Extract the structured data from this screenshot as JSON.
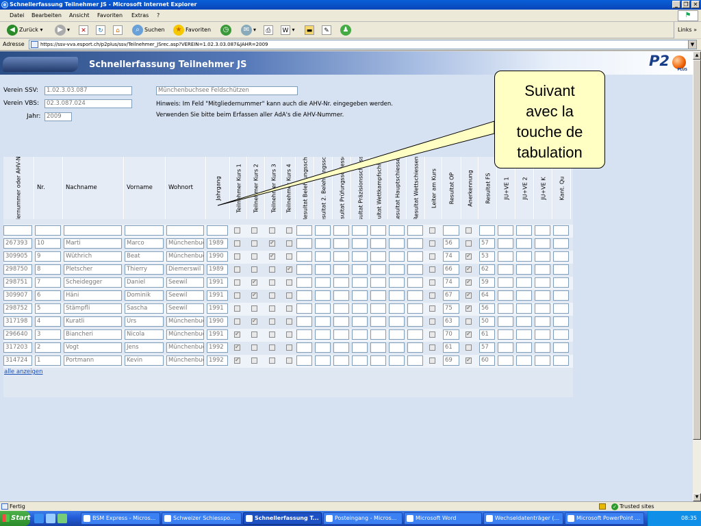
{
  "window": {
    "title": "Schnellerfassung Teilnehmer JS - Microsoft Internet Explorer",
    "min": "_",
    "max": "❐",
    "close": "✕"
  },
  "menu": [
    "Datei",
    "Bearbeiten",
    "Ansicht",
    "Favoriten",
    "Extras",
    "?"
  ],
  "toolbar": {
    "back": "Zurück",
    "search": "Suchen",
    "favorites": "Favoriten",
    "links": "Links"
  },
  "address": {
    "label": "Adresse",
    "url": "https://ssv-vva.esport.ch/p2plus/ssv/Teilnehmer_JSrec.asp?VEREIN=1.02.3.03.087&JAHR=2009"
  },
  "page": {
    "title": "Schnellerfassung Teilnehmer JS",
    "logo": "P2",
    "logo_sub": "PLUS"
  },
  "form": {
    "verein_ssv_label": "Verein SSV:",
    "verein_ssv": "1.02.3.03.087",
    "verein_vbs_label": "Verein VBS:",
    "verein_vbs": "02.3.087.024",
    "jahr_label": "Jahr:",
    "jahr": "2009",
    "verein_name": "Münchenbuchsee Feldschützen",
    "hint1": "Hinweis: Im Feld \"Mitgliedernummer\" kann auch die AHV-Nr. eingegeben werden.",
    "hint2": "Verwenden Sie bitte beim Erfassen aller AdA's die AHV-Nummer."
  },
  "columns": [
    {
      "label": "Mitgliedernummer oder AHV-Nummer",
      "rot": true
    },
    {
      "label": "Nr.",
      "rot": false
    },
    {
      "label": "Nachname",
      "rot": false
    },
    {
      "label": "Vorname",
      "rot": false
    },
    {
      "label": "Wohnort",
      "rot": false
    },
    {
      "label": "Jahrgang",
      "rot": true
    },
    {
      "label": "Teilnehmer Kurs 1",
      "rot": true
    },
    {
      "label": "Teilnehmer Kurs 2",
      "rot": true
    },
    {
      "label": "Teilnehmer Kurs 3",
      "rot": true
    },
    {
      "label": "Teilnehmer Kurs 4",
      "rot": true
    },
    {
      "label": "Resultat Belehrungssch.",
      "rot": true
    },
    {
      "label": "Resultat 2. Belehrungssch.",
      "rot": true
    },
    {
      "label": "Resultat Prüfungsschiessen",
      "rot": true
    },
    {
      "label": "Resultat Präzisionsschiessen",
      "rot": true
    },
    {
      "label": "Resultat Wettkampfschiessen",
      "rot": true
    },
    {
      "label": "Resultat Hauptschiessen",
      "rot": true
    },
    {
      "label": "Resultat Wettschiessen",
      "rot": true
    },
    {
      "label": "Leiter am Kurs",
      "rot": true
    },
    {
      "label": "Resultat OP",
      "rot": true
    },
    {
      "label": "Anerkennung",
      "rot": true
    },
    {
      "label": "Resultat FS",
      "rot": true
    },
    {
      "label": "JU+VE 1",
      "rot": true
    },
    {
      "label": "JU+VE 2",
      "rot": true
    },
    {
      "label": "JU+VE K",
      "rot": true
    },
    {
      "label": "Kant. Qu",
      "rot": true
    }
  ],
  "rows": [
    {
      "mnr": "",
      "nr": "",
      "name": "",
      "vorname": "",
      "ort": "",
      "jg": "",
      "k": [
        false,
        false,
        false,
        false
      ],
      "leiter": false,
      "op": "",
      "aner": false,
      "fs": ""
    },
    {
      "mnr": "267393",
      "nr": "10",
      "name": "Marti",
      "vorname": "Marco",
      "ort": "Münchenbuchsee",
      "jg": "1989",
      "k": [
        false,
        false,
        true,
        false
      ],
      "leiter": false,
      "op": "56",
      "aner": false,
      "fs": "57"
    },
    {
      "mnr": "309905",
      "nr": "9",
      "name": "Wüthrich",
      "vorname": "Beat",
      "ort": "Münchenbuchsee",
      "jg": "1990",
      "k": [
        false,
        false,
        true,
        false
      ],
      "leiter": false,
      "op": "74",
      "aner": true,
      "fs": "53"
    },
    {
      "mnr": "298750",
      "nr": "8",
      "name": "Pletscher",
      "vorname": "Thierry",
      "ort": "Diemerswil",
      "jg": "1989",
      "k": [
        false,
        false,
        false,
        true
      ],
      "leiter": false,
      "op": "66",
      "aner": true,
      "fs": "62"
    },
    {
      "mnr": "298751",
      "nr": "7",
      "name": "Scheidegger",
      "vorname": "Daniel",
      "ort": "Seewil",
      "jg": "1991",
      "k": [
        false,
        true,
        false,
        false
      ],
      "leiter": false,
      "op": "74",
      "aner": true,
      "fs": "59"
    },
    {
      "mnr": "309907",
      "nr": "6",
      "name": "Häni",
      "vorname": "Dominik",
      "ort": "Seewil",
      "jg": "1991",
      "k": [
        false,
        true,
        false,
        false
      ],
      "leiter": false,
      "op": "67",
      "aner": true,
      "fs": "64"
    },
    {
      "mnr": "298752",
      "nr": "5",
      "name": "Stämpfli",
      "vorname": "Sascha",
      "ort": "Seewil",
      "jg": "1991",
      "k": [
        false,
        false,
        false,
        false
      ],
      "leiter": false,
      "op": "75",
      "aner": true,
      "fs": "56"
    },
    {
      "mnr": "317198",
      "nr": "4",
      "name": "Kuratli",
      "vorname": "Urs",
      "ort": "Münchenbuchsee",
      "jg": "1990",
      "k": [
        false,
        true,
        false,
        false
      ],
      "leiter": false,
      "op": "63",
      "aner": false,
      "fs": "50"
    },
    {
      "mnr": "296640",
      "nr": "3",
      "name": "Biancheri",
      "vorname": "Nicola",
      "ort": "Münchenbuchsee",
      "jg": "1991",
      "k": [
        true,
        false,
        false,
        false
      ],
      "leiter": false,
      "op": "70",
      "aner": true,
      "fs": "61"
    },
    {
      "mnr": "317203",
      "nr": "2",
      "name": "Vogt",
      "vorname": "Jens",
      "ort": "Münchenbuchsee",
      "jg": "1992",
      "k": [
        true,
        false,
        false,
        false
      ],
      "leiter": false,
      "op": "61",
      "aner": false,
      "fs": "57"
    },
    {
      "mnr": "314724",
      "nr": "1",
      "name": "Portmann",
      "vorname": "Kevin",
      "ort": "Münchenbuchsee",
      "jg": "1992",
      "k": [
        true,
        false,
        false,
        false
      ],
      "leiter": false,
      "op": "69",
      "aner": true,
      "fs": "60"
    }
  ],
  "show_all": "alle anzeigen",
  "callout": {
    "line1": "Suivant",
    "line2": "avec la",
    "line3": "touche de",
    "line4": "tabulation"
  },
  "status": {
    "text": "Fertig",
    "zone": "Trusted sites"
  },
  "taskbar": {
    "start": "Start",
    "tasks": [
      "BSM Express - Micros...",
      "Schweizer Schiesspo...",
      "Schnellerfassung T...",
      "Posteingang - Micros...",
      "Microsoft Word",
      "Wechseldatenträger (...",
      "Microsoft PowerPoint ..."
    ],
    "active": 2,
    "clock": "08:35"
  }
}
